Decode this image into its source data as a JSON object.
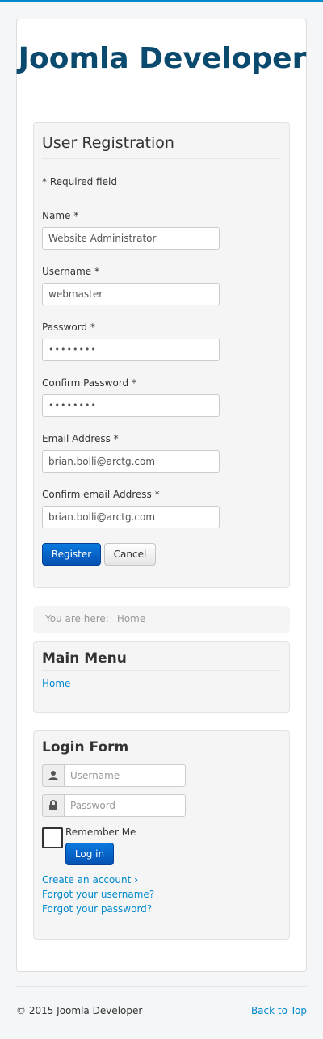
{
  "site": {
    "title": "Joomla Developer"
  },
  "registration": {
    "legend": "User Registration",
    "required_note": "* Required field",
    "fields": [
      {
        "label": "Name *",
        "value": "Website Administrator"
      },
      {
        "label": "Username *",
        "value": "webmaster"
      },
      {
        "label": "Password *",
        "value": "••••••••"
      },
      {
        "label": "Confirm Password *",
        "value": "••••••••"
      },
      {
        "label": "Email Address *",
        "value": "brian.bolli@arctg.com"
      },
      {
        "label": "Confirm email Address *",
        "value": "brian.bolli@arctg.com"
      }
    ],
    "register_label": "Register",
    "cancel_label": "Cancel"
  },
  "breadcrumb": {
    "prefix": "You are here:",
    "home": "Home"
  },
  "main_menu": {
    "title": "Main Menu",
    "items": [
      {
        "label": "Home"
      }
    ]
  },
  "login_form": {
    "title": "Login Form",
    "username_placeholder": "Username",
    "password_placeholder": "Password",
    "remember_label": "Remember Me",
    "login_label": "Log in",
    "create_account": "Create an account",
    "forgot_username": "Forgot your username?",
    "forgot_password": "Forgot your password?"
  },
  "footer": {
    "copyright": "© 2015 Joomla Developer",
    "back_to_top": "Back to Top"
  },
  "colors": {
    "accent": "#0088cc",
    "title": "#0b4a6f",
    "primary_button": "#0551b3"
  }
}
